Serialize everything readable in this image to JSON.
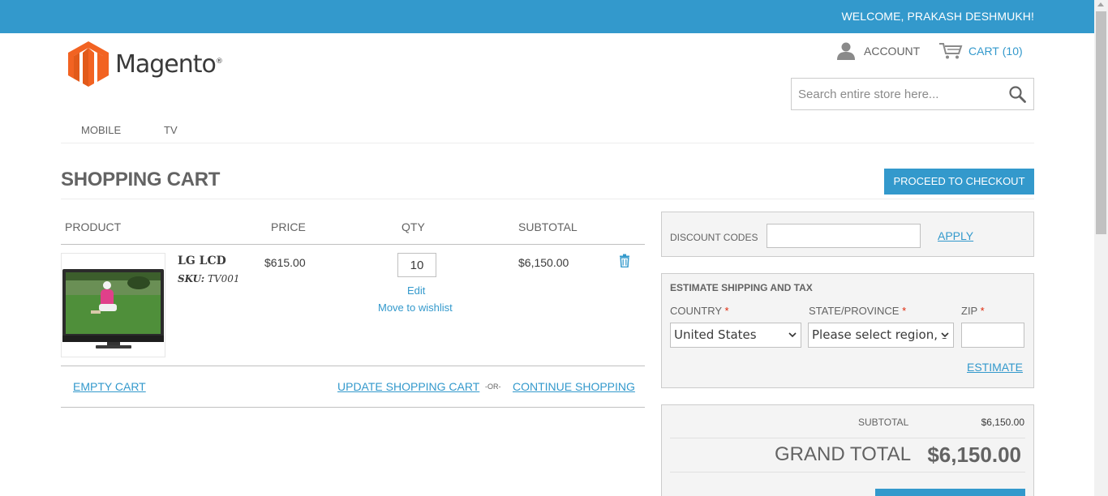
{
  "header": {
    "welcome": "WELCOME, PRAKASH DESHMUKH!",
    "logo_text": "Magento",
    "logo_reg": "®",
    "account_label": "ACCOUNT",
    "cart_label": "CART",
    "cart_count": "(10)",
    "search_placeholder": "Search entire store here..."
  },
  "nav": {
    "items": [
      {
        "label": "MOBILE"
      },
      {
        "label": "TV"
      }
    ]
  },
  "page": {
    "title": "SHOPPING CART",
    "checkout_label": "PROCEED TO CHECKOUT"
  },
  "cart_table": {
    "headers": {
      "product": "PRODUCT",
      "price": "PRICE",
      "qty": "QTY",
      "subtotal": "SUBTOTAL"
    },
    "items": [
      {
        "name": "LG LCD",
        "sku_label": "SKU:",
        "sku": "TV001",
        "price": "$615.00",
        "qty": "10",
        "subtotal": "$6,150.00",
        "edit_label": "Edit",
        "wishlist_label": "Move to wishlist"
      }
    ],
    "empty_cart": "EMPTY CART",
    "update_cart": "UPDATE SHOPPING CART",
    "or": "-OR-",
    "continue_shopping": "CONTINUE SHOPPING"
  },
  "discount": {
    "label": "DISCOUNT CODES",
    "value": "",
    "apply_label": "APPLY"
  },
  "shipping": {
    "title": "ESTIMATE SHIPPING AND TAX",
    "country_label": "COUNTRY",
    "country_value": "United States",
    "state_label": "STATE/PROVINCE",
    "state_value": "Please select region, s",
    "zip_label": "ZIP",
    "zip_value": "",
    "required_mark": "*",
    "estimate_label": "ESTIMATE"
  },
  "totals": {
    "subtotal_label": "SUBTOTAL",
    "subtotal_value": "$6,150.00",
    "grand_label": "GRAND TOTAL",
    "grand_value": "$6,150.00"
  },
  "colors": {
    "accent": "#3399cc",
    "logo_orange": "#f26322",
    "required": "#df280a"
  }
}
